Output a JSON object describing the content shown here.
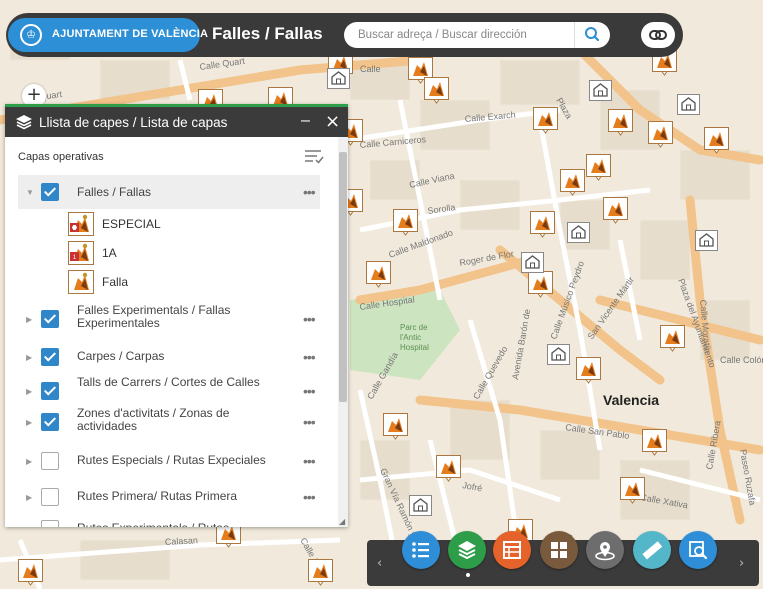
{
  "header": {
    "brand_text": "AJUNTAMENT DE VALÈNCIA",
    "app_title": "Falles / Fallas",
    "search_placeholder": "Buscar adreça / Buscar dirección",
    "brand_color": "#2d8fd6"
  },
  "map": {
    "city_label": "Valencia",
    "street_labels": [
      "Calle Quart",
      "Quart",
      "Calle",
      "Calle Exarch",
      "Plaza Mercado",
      "Calle Carniceros",
      "Calle Viana",
      "Calle Sorolla",
      "Calle Maldonado",
      "Roger de Flor",
      "Calle Hospital",
      "Parc de l'Antic Hospital",
      "Calle Quevedo",
      "Avenida Barón de Cárcer",
      "Calle Músico Peydro",
      "San Vicente Mártir",
      "Calle San Pablo",
      "Calle Ribera",
      "Paseo Ruzafa",
      "Calle Xativa",
      "Calle Moratín",
      "Plaza del Ayuntamiento",
      "Calle Gandía",
      "Calle Alcira",
      "Calle Calasan",
      "Gran Vía Ramón y Cajal",
      "Jofré",
      "Calle Colón"
    ],
    "zoom_in_label": "+"
  },
  "panel": {
    "title": "Llista de capes / Lista de capas",
    "minimize_label": "–",
    "close_label": "×",
    "section_label": "Capas operativas",
    "layers": [
      {
        "name": "Falles / Fallas",
        "checked": true,
        "expanded": true
      },
      {
        "name": "Falles Experimentals / Fallas Experimentales",
        "checked": true,
        "expanded": false
      },
      {
        "name": "Carpes / Carpas",
        "checked": true,
        "expanded": false
      },
      {
        "name": "Talls de Carrers / Cortes de Calles",
        "checked": true,
        "expanded": false
      },
      {
        "name": "Zones d'activitats / Zonas de actividades",
        "checked": true,
        "expanded": false
      },
      {
        "name": "Rutes Especials / Rutas Expeciales",
        "checked": false,
        "expanded": false
      },
      {
        "name": "Rutes Primera/ Rutas Primera",
        "checked": false,
        "expanded": false
      },
      {
        "name": "Rutes Experimentals / Rutas",
        "checked": false,
        "expanded": false
      }
    ],
    "legend": [
      {
        "label": "ESPECIAL",
        "icon": "falla-especial-icon"
      },
      {
        "label": "1A",
        "icon": "falla-1a-icon"
      },
      {
        "label": "Falla",
        "icon": "falla-icon"
      }
    ],
    "more_label": "•••"
  },
  "toolbar": {
    "buttons": [
      {
        "name": "legend-button",
        "icon": "list-icon",
        "color": "#2e8fd8"
      },
      {
        "name": "layer-list-button",
        "icon": "layers-icon",
        "color": "#2e9d4a"
      },
      {
        "name": "attribute-table-button",
        "icon": "table-icon",
        "color": "#e5622a"
      },
      {
        "name": "basemap-gallery-button",
        "icon": "grid-icon",
        "color": "#7a5a3c"
      },
      {
        "name": "location-button",
        "icon": "location-icon",
        "color": "#6d6d6d"
      },
      {
        "name": "measure-button",
        "icon": "ruler-icon",
        "color": "#54b6c9"
      },
      {
        "name": "query-button",
        "icon": "search-map-icon",
        "color": "#2e8fd8"
      }
    ],
    "prev_label": "‹",
    "next_label": "›"
  }
}
